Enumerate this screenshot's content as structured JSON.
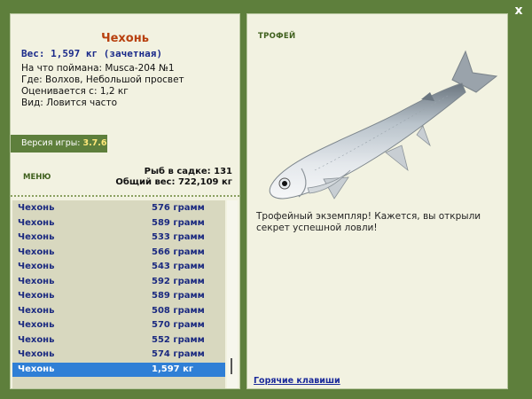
{
  "close_label": "x",
  "fish": {
    "name": "Чехонь",
    "weight_line": "Вес: 1,597 кг (зачетная)",
    "bait": "На что поймана: Musca-204 №1",
    "location": "Где: Волхов, Небольшой просвет",
    "rated_from": "Оценивается с: 1,2 кг",
    "frequency": "Вид: Ловится часто"
  },
  "version": {
    "label": "Версия игры:",
    "value": "3.7.6"
  },
  "menu_label": "МЕНЮ",
  "stats": {
    "count_line": "Рыб в садке: 131",
    "total_line": "Общий вес: 722,109 кг"
  },
  "catch_list": [
    {
      "name": "Чехонь",
      "weight": "576 грамм"
    },
    {
      "name": "Чехонь",
      "weight": "589 грамм"
    },
    {
      "name": "Чехонь",
      "weight": "533 грамм"
    },
    {
      "name": "Чехонь",
      "weight": "566 грамм"
    },
    {
      "name": "Чехонь",
      "weight": "543 грамм"
    },
    {
      "name": "Чехонь",
      "weight": "592 грамм"
    },
    {
      "name": "Чехонь",
      "weight": "589 грамм"
    },
    {
      "name": "Чехонь",
      "weight": "508 грамм"
    },
    {
      "name": "Чехонь",
      "weight": "570 грамм"
    },
    {
      "name": "Чехонь",
      "weight": "552 грамм"
    },
    {
      "name": "Чехонь",
      "weight": "574 грамм"
    },
    {
      "name": "Чехонь",
      "weight": "1,597 кг"
    }
  ],
  "selected_index": 11,
  "trophy": {
    "label": "ТРОФЕЙ",
    "text": "Трофейный экземпляр! Кажется, вы открыли секрет успешной ловли!"
  },
  "hotkeys_label": "Горячие клавиши",
  "colors": {
    "frame": "#5e7f3c",
    "panel": "#f2f2e1",
    "selected": "#2f7fd6",
    "title": "#b8400e",
    "list_text": "#1b2a80"
  }
}
